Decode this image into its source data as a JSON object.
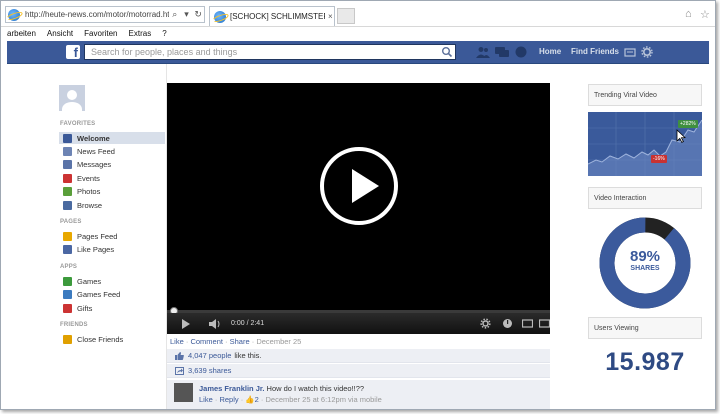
{
  "browser": {
    "url": "http://heute-news.com/motor/motorrad.htm",
    "tab_title": "[SCHOCK] SCHLIMMSTER ...",
    "tab_close": "×",
    "menu": [
      "arbeiten",
      "Ansicht",
      "Favoriten",
      "Extras",
      "?"
    ]
  },
  "fb_header": {
    "logo": "f",
    "search_placeholder": "Search for people, places and things",
    "links": {
      "home": "Home",
      "find_friends": "Find Friends"
    }
  },
  "sidebar": {
    "sections": [
      {
        "heading": "FAVORITES",
        "items": [
          {
            "label": "Welcome",
            "icon": "facebook-icon",
            "color": "#3b5998",
            "active": true
          },
          {
            "label": "News Feed",
            "icon": "news-feed-icon",
            "color": "#6d84b4"
          },
          {
            "label": "Messages",
            "icon": "messages-icon",
            "color": "#5b74a8"
          },
          {
            "label": "Events",
            "icon": "events-icon",
            "color": "#c33"
          },
          {
            "label": "Photos",
            "icon": "photos-icon",
            "color": "#5a9f3a"
          },
          {
            "label": "Browse",
            "icon": "browse-icon",
            "color": "#4a6aa0"
          }
        ]
      },
      {
        "heading": "PAGES",
        "items": [
          {
            "label": "Pages Feed",
            "icon": "pages-feed-icon",
            "color": "#e8a800"
          },
          {
            "label": "Like Pages",
            "icon": "like-pages-icon",
            "color": "#4b67a3"
          }
        ]
      },
      {
        "heading": "APPS",
        "items": [
          {
            "label": "Games",
            "icon": "games-icon",
            "color": "#3c9a3c"
          },
          {
            "label": "Games Feed",
            "icon": "games-feed-icon",
            "color": "#3c7bbf"
          },
          {
            "label": "Gifts",
            "icon": "gifts-icon",
            "color": "#cc3333"
          }
        ]
      },
      {
        "heading": "FRIENDS",
        "items": [
          {
            "label": "Close Friends",
            "icon": "close-friends-icon",
            "color": "#e0a000"
          }
        ]
      }
    ]
  },
  "video": {
    "time": "0:00 / 2:41",
    "progress": 0
  },
  "post": {
    "actions": {
      "like": "Like",
      "comment": "Comment",
      "share": "Share",
      "date": "December 25",
      "sep": " · "
    },
    "likes": {
      "count": "4,047 people",
      "suffix": "like this."
    },
    "shares": {
      "count": "3,639 shares"
    },
    "comment": {
      "author": "James Franklin Jr.",
      "text": "How do I watch this video!!??",
      "like": "Like",
      "reply": "Reply",
      "like_count": "2",
      "meta": "December 25 at 6:12pm via mobile"
    }
  },
  "right": {
    "trending": {
      "title": "Trending Viral Video",
      "up_badge": "+282%",
      "down_badge": "-16%"
    },
    "interaction": {
      "title": "Video Interaction",
      "percent": "89%",
      "label": "SHARES",
      "share_fraction": 0.89
    },
    "viewers": {
      "title": "Users Viewing",
      "count": "15.987"
    }
  },
  "colors": {
    "fb_blue": "#3b5998",
    "donut_blue": "#3b5a9c",
    "donut_dark": "#222222"
  }
}
